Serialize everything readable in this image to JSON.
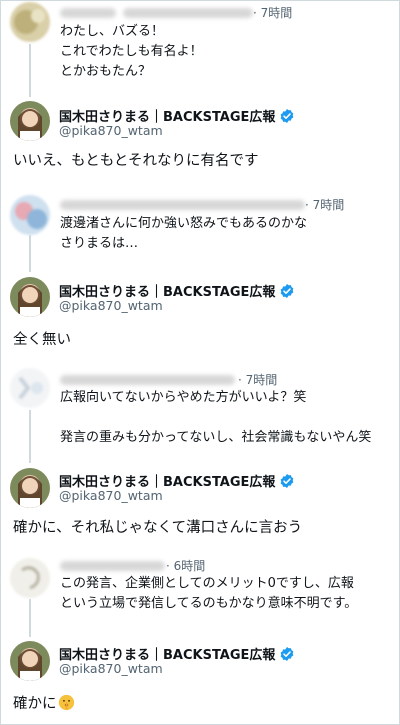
{
  "colors": {
    "border": "#cfd9de",
    "verified": "#1d9bf0",
    "secondary_text": "#536471",
    "primary_text": "#0f1419"
  },
  "account": {
    "name": "国木田さりまる｜BACKSTAGE広報",
    "handle": "@pika870_wtam",
    "verified_icon": "verified-badge-icon"
  },
  "thread": [
    {
      "reply": {
        "time": "· 7時間",
        "text": "わたし、バズる！\nこれでわたしも有名よ！\nとかおもたん？"
      },
      "response": {
        "text": "いいえ、もともとそれなりに有名です"
      }
    },
    {
      "reply": {
        "time": "· 7時間",
        "text": "渡邊渚さんに何か強い怒みでもあるのかな\nさりまるは…"
      },
      "response": {
        "text": "全く無い"
      }
    },
    {
      "reply": {
        "time": "· 7時間",
        "text": "広報向いてないからやめた方がいいよ？笑\n\n発言の重みも分かってないし、社会常識もないやん笑"
      },
      "response": {
        "text": "確かに、それ私じゃなくて溝口さんに言おう"
      }
    },
    {
      "reply": {
        "time": "· 6時間",
        "text": "この発言、企業側としてのメリット0ですし、広報\nという立場で発信してるのもかなり意味不明です。"
      },
      "response": {
        "text": "確かに",
        "emoji": "shushing-face-emoji"
      }
    }
  ]
}
